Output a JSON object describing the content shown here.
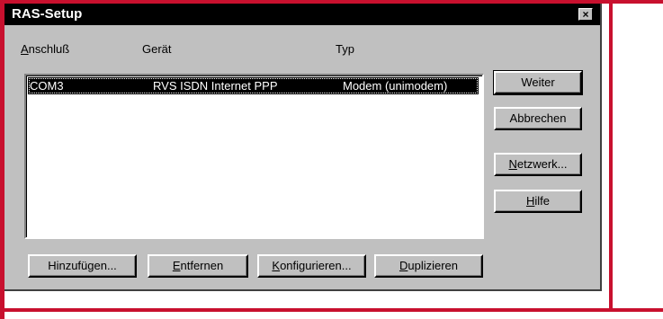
{
  "window": {
    "title": "RAS-Setup",
    "close_glyph": "×"
  },
  "list": {
    "columns": [
      {
        "prefix": "",
        "mnemonic": "A",
        "rest": "nschluß"
      },
      {
        "label": "Gerät"
      },
      {
        "label": "Typ"
      }
    ],
    "rows": [
      {
        "port": "COM3",
        "device": "RVS ISDN Internet PPP",
        "type": "Modem (unimodem)",
        "selected": true
      }
    ]
  },
  "side_buttons": {
    "weiter": "Weiter",
    "abbrechen": "Abbrechen",
    "netzwerk": {
      "mnemonic": "N",
      "rest": "etzwerk..."
    },
    "hilfe": {
      "mnemonic": "H",
      "rest": "ilfe"
    }
  },
  "bottom_buttons": {
    "hinzufuegen": "Hinzufügen...",
    "entfernen": {
      "mnemonic": "E",
      "rest": "ntfernen"
    },
    "konfigurieren": {
      "mnemonic": "K",
      "rest": "onfigurieren..."
    },
    "duplizieren": {
      "mnemonic": "D",
      "rest": "uplizieren"
    }
  },
  "colors": {
    "frame_red": "#c8102e",
    "dialog_face": "#c0c0c0",
    "titlebar": "#000000",
    "selection": "#000000"
  }
}
